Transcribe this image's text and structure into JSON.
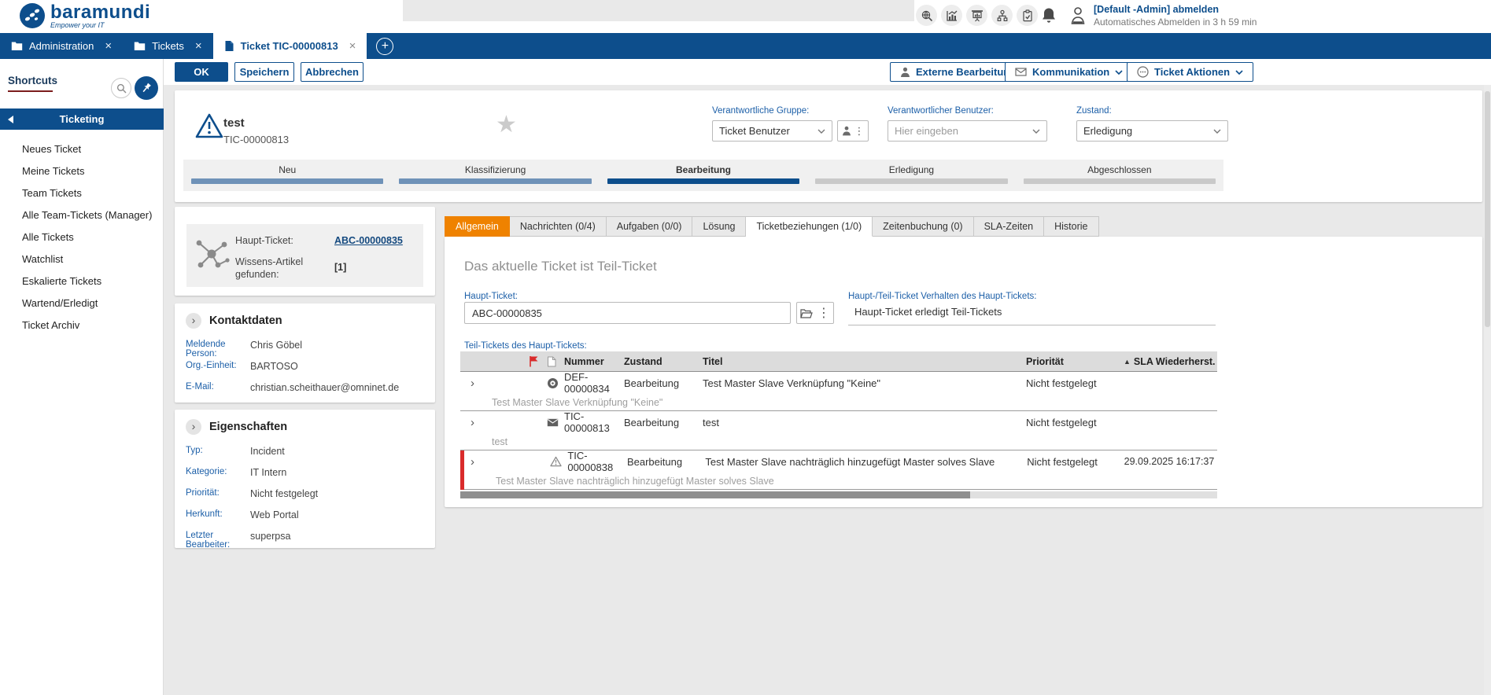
{
  "colors": {
    "brand_navy": "#0d4e8c",
    "accent_orange": "#ef8200",
    "steel_blue": "#6f92b8",
    "label_blue": "#1c5fa8",
    "alert_red": "#d92b2b",
    "star_gray": "#cbcbcb"
  },
  "topbar": {
    "logo_text": "baramundi",
    "logo_tagline": "Empower your IT",
    "icons": [
      "global-search-icon",
      "statistics-icon",
      "dashboard-icon",
      "org-structure-icon",
      "tasks-clipboard-icon",
      "notifications-bell-icon",
      "user-icon"
    ],
    "user_logout": "[Default -Admin] abmelden",
    "auto_logout": "Automatisches Abmelden in 3 h 59 min"
  },
  "window_tabs": {
    "close_glyph": "×",
    "plus_glyph": "+",
    "tabs": [
      {
        "label": "Administration",
        "icon": "folder-icon"
      },
      {
        "label": "Tickets",
        "icon": "folder-icon"
      },
      {
        "label": "Ticket TIC-00000813",
        "icon": "document-icon"
      }
    ]
  },
  "toolbar": {
    "ok": "OK",
    "save": "Speichern",
    "cancel": "Abbrechen",
    "external_edit": "Externe Bearbeitung",
    "communication": "Kommunikation",
    "ticket_actions": "Ticket Aktionen"
  },
  "sidebar": {
    "shortcuts_title": "Shortcuts",
    "section_title": "Ticketing",
    "items": [
      {
        "label": "Neues Ticket"
      },
      {
        "label": "Meine Tickets"
      },
      {
        "label": "Team Tickets"
      },
      {
        "label": "Alle Team-Tickets (Manager)"
      },
      {
        "label": "Alle Tickets"
      },
      {
        "label": "Watchlist"
      },
      {
        "label": "Eskalierte Tickets"
      },
      {
        "label": "Wartend/Erledigt"
      },
      {
        "label": "Ticket Archiv"
      }
    ]
  },
  "ticket": {
    "title": "test",
    "number": "TIC-00000813",
    "responsible_group_label": "Verantwortliche Gruppe:",
    "responsible_group_value": "Ticket Benutzer",
    "responsible_user_label": "Verantwortlicher Benutzer:",
    "responsible_user_placeholder": "Hier eingeben",
    "state_label": "Zustand:",
    "state_value": "Erledigung",
    "stages": [
      {
        "label": "Neu",
        "status": "done"
      },
      {
        "label": "Klassifizierung",
        "status": "done"
      },
      {
        "label": "Bearbeitung",
        "status": "current"
      },
      {
        "label": "Erledigung",
        "status": "open"
      },
      {
        "label": "Abgeschlossen",
        "status": "open"
      }
    ]
  },
  "relations_card": {
    "main_ticket_label": "Haupt-Ticket:",
    "main_ticket_link": "ABC-00000835",
    "knowledge_label": "Wissens-Artikel gefunden:",
    "knowledge_value": "[1]"
  },
  "contact_card": {
    "title": "Kontaktdaten",
    "rows": [
      {
        "label": "Meldende Person:",
        "value": "Chris Göbel"
      },
      {
        "label": "Org.-Einheit:",
        "value": "BARTOSO"
      },
      {
        "label": "E-Mail:",
        "value": "christian.scheithauer@omninet.de"
      }
    ]
  },
  "properties_card": {
    "title": "Eigenschaften",
    "rows": [
      {
        "label": "Typ:",
        "value": "Incident"
      },
      {
        "label": "Kategorie:",
        "value": "IT Intern"
      },
      {
        "label": "Priorität:",
        "value": "Nicht festgelegt"
      },
      {
        "label": "Herkunft:",
        "value": "Web Portal"
      },
      {
        "label": "Letzter Bearbeiter:",
        "value": "superpsa"
      }
    ]
  },
  "panel": {
    "tabs": [
      {
        "label": "Allgemein",
        "style": "orange"
      },
      {
        "label": "Nachrichten (0/4)",
        "style": "normal"
      },
      {
        "label": "Aufgaben (0/0)",
        "style": "normal"
      },
      {
        "label": "Lösung",
        "style": "normal"
      },
      {
        "label": "Ticketbeziehungen (1/0)",
        "style": "active"
      },
      {
        "label": "Zeitenbuchung (0)",
        "style": "normal"
      },
      {
        "label": "SLA-Zeiten",
        "style": "normal"
      },
      {
        "label": "Historie",
        "style": "normal"
      }
    ],
    "heading": "Das aktuelle Ticket ist Teil-Ticket",
    "main_ticket_label": "Haupt-Ticket:",
    "main_ticket_value": "ABC-00000835",
    "behavior_label": "Haupt-/Teil-Ticket Verhalten des Haupt-Tickets:",
    "behavior_value": "Haupt-Ticket erledigt Teil-Tickets",
    "table_caption": "Teil-Tickets des Haupt-Tickets:",
    "table": {
      "headers": {
        "nummer": "Nummer",
        "zustand": "Zustand",
        "titel": "Titel",
        "prioritaet": "Priorität",
        "sla": "SLA Wiederherst."
      },
      "rows": [
        {
          "icon": "target-circle-icon",
          "number": "DEF-00000834",
          "state": "Bearbeitung",
          "title": "Test Master Slave Verknüpfung \"Keine\"",
          "priority": "Nicht festgelegt",
          "sla": "",
          "description": "Test Master Slave Verknüpfung \"Keine\"",
          "alert": false
        },
        {
          "icon": "envelope-icon",
          "number": "TIC-00000813",
          "state": "Bearbeitung",
          "title": "test",
          "priority": "Nicht festgelegt",
          "sla": "",
          "description": "test",
          "alert": false
        },
        {
          "icon": "warning-triangle-icon",
          "number": "TIC-00000838",
          "state": "Bearbeitung",
          "title": "Test Master Slave nachträglich hinzugefügt Master solves Slave",
          "priority": "Nicht festgelegt",
          "sla": "29.09.2025 16:17:37",
          "description": "Test Master Slave nachträglich hinzugefügt Master solves Slave",
          "alert": true
        }
      ]
    }
  }
}
